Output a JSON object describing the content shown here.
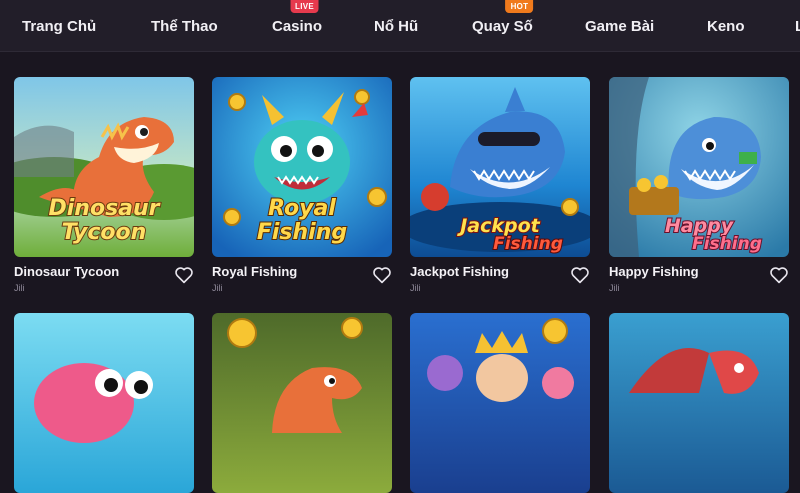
{
  "nav": {
    "items": [
      {
        "label": "Trang Chủ"
      },
      {
        "label": "Thể Thao"
      },
      {
        "label": "Casino",
        "badge": "LIVE",
        "badge_color": "#e63a4d"
      },
      {
        "label": "Nổ Hũ"
      },
      {
        "label": "Quay Số",
        "badge": "HOT",
        "badge_color": "#f07a1c"
      },
      {
        "label": "Game Bài"
      },
      {
        "label": "Keno"
      },
      {
        "label": "L"
      }
    ]
  },
  "games": [
    {
      "title": "Dinosaur Tycoon",
      "provider": "Jili",
      "logo_line1": "Dinosaur",
      "logo_line2": "Tycoon"
    },
    {
      "title": "Royal Fishing",
      "provider": "Jili",
      "logo_line1": "Royal",
      "logo_line2": "Fishing"
    },
    {
      "title": "Jackpot Fishing",
      "provider": "Jili",
      "logo_line1": "Jackpot",
      "logo_line2": "Fishing"
    },
    {
      "title": "Happy Fishing",
      "provider": "Jili",
      "logo_line1": "Happy",
      "logo_line2": "Fishing"
    },
    {
      "title": "",
      "provider": ""
    },
    {
      "title": "",
      "provider": ""
    },
    {
      "title": "",
      "provider": ""
    },
    {
      "title": "",
      "provider": ""
    }
  ],
  "icons": {
    "favorite": "heart-outline-icon"
  },
  "colors": {
    "background": "#1a1620",
    "nav_background": "#221e29",
    "live_badge": "#e63a4d",
    "hot_badge": "#f07a1c"
  }
}
